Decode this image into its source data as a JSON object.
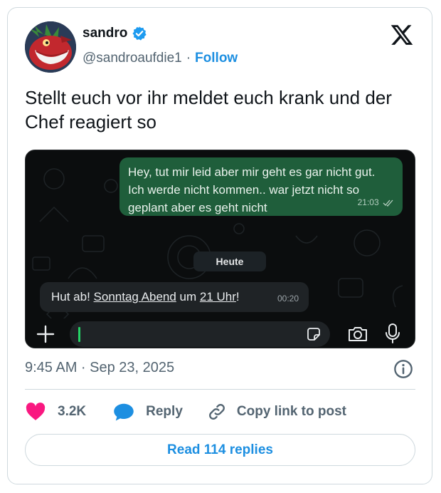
{
  "author": {
    "name": "sandro",
    "handle": "@sandroaufdie1",
    "separator": "·",
    "follow_label": "Follow"
  },
  "tweet": {
    "text": "Stellt euch vor ihr meldet euch krank und der Chef reagiert so"
  },
  "chat": {
    "outgoing": {
      "text": "Hey, tut mir leid aber mir geht es gar nicht gut. Ich werde nicht kommen.. war jetzt nicht so geplant aber es geht nicht",
      "time": "21:03"
    },
    "day_label": "Heute",
    "incoming": {
      "part1": "Hut ab! ",
      "link1": "Sonntag Abend",
      "part2": " um ",
      "link2": "21 Uhr",
      "part3": "!",
      "time": "00:20"
    }
  },
  "meta": {
    "timestamp": "9:45 AM · Sep 23, 2025"
  },
  "actions": {
    "like_count": "3.2K",
    "reply_label": "Reply",
    "copy_link_label": "Copy link to post"
  },
  "read_replies_label": "Read 114 replies",
  "colors": {
    "accent": "#1d8fe1",
    "like": "#f91880",
    "chat_out": "#1f5e3b",
    "chat_in": "#1f2326"
  },
  "icons": [
    "verified-badge-icon",
    "x-logo-icon",
    "plus-icon",
    "sticker-icon",
    "camera-icon",
    "mic-icon",
    "info-icon",
    "heart-icon",
    "reply-bubble-icon",
    "link-icon"
  ]
}
